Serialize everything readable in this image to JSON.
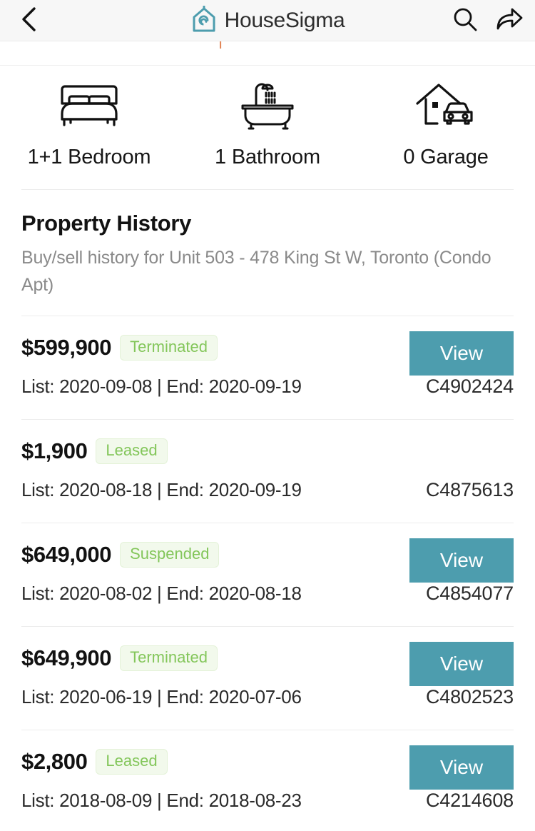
{
  "header": {
    "back_icon": "chevron-left-icon",
    "brand": "HouseSigma",
    "logo_icon": "housesigma-logo-icon",
    "logo_color": "#4d9dae",
    "search_icon": "search-icon",
    "share_icon": "share-arrow-icon"
  },
  "features": [
    {
      "icon": "bed-icon",
      "label": "1+1 Bedroom"
    },
    {
      "icon": "bathtub-icon",
      "label": "1 Bathroom"
    },
    {
      "icon": "garage-icon",
      "label": "0 Garage"
    }
  ],
  "property_history": {
    "title": "Property History",
    "subtitle": "Buy/sell history for Unit 503 - 478 King St W, Toronto (Condo Apt)",
    "view_label": "View",
    "accent_color": "#4d9dae",
    "badge_text_color": "#83c65a",
    "badge_bg_color": "#f2f9ec",
    "rows": [
      {
        "price": "$599,900",
        "status": "Terminated",
        "dates": "List: 2020-09-08 | End: 2020-09-19",
        "mls": "C4902424",
        "has_view": true
      },
      {
        "price": "$1,900",
        "status": "Leased",
        "dates": "List: 2020-08-18 | End: 2020-09-19",
        "mls": "C4875613",
        "has_view": false
      },
      {
        "price": "$649,000",
        "status": "Suspended",
        "dates": "List: 2020-08-02 | End: 2020-08-18",
        "mls": "C4854077",
        "has_view": true
      },
      {
        "price": "$649,900",
        "status": "Terminated",
        "dates": "List: 2020-06-19 | End: 2020-07-06",
        "mls": "C4802523",
        "has_view": true
      },
      {
        "price": "$2,800",
        "status": "Leased",
        "dates": "List: 2018-08-09 | End: 2018-08-23",
        "mls": "C4214608",
        "has_view": true
      }
    ]
  }
}
